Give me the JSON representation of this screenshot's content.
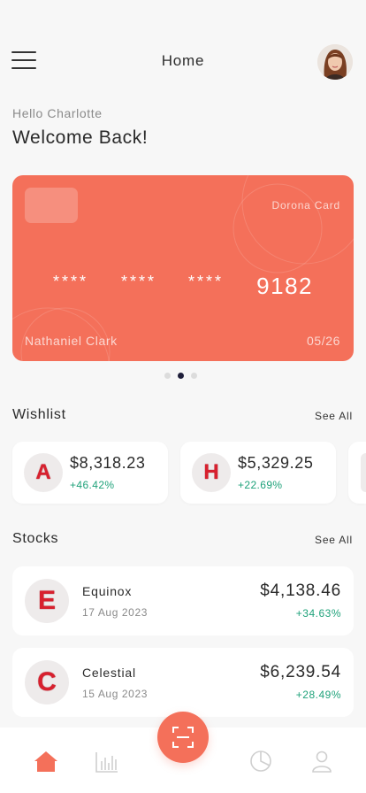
{
  "header": {
    "title": "Home"
  },
  "greeting": {
    "hello": "Hello Charlotte",
    "welcome": "Welcome Back!"
  },
  "card": {
    "brand": "Dorona Card",
    "masked_groups": [
      "****",
      "****",
      "****"
    ],
    "last_digits": "9182",
    "holder": "Nathaniel Clark",
    "expiry": "05/26",
    "color": "#f4705a"
  },
  "carousel": {
    "count": 3,
    "active_index": 1
  },
  "wishlist": {
    "title": "Wishlist",
    "see_all": "See All",
    "items": [
      {
        "logo_letter": "A",
        "price": "$8,318.23",
        "change": "+46.42%"
      },
      {
        "logo_letter": "H",
        "price": "$5,329.25",
        "change": "+22.69%"
      }
    ]
  },
  "stocks": {
    "title": "Stocks",
    "see_all": "See All",
    "items": [
      {
        "logo_letter": "E",
        "name": "Equinox",
        "date": "17 Aug 2023",
        "price": "$4,138.46",
        "change": "+34.63%"
      },
      {
        "logo_letter": "C",
        "name": "Celestial",
        "date": "15 Aug 2023",
        "price": "$6,239.54",
        "change": "+28.49%"
      }
    ]
  },
  "nav": {
    "items": [
      "home-icon",
      "bar-chart-icon",
      "scan-icon",
      "pie-chart-icon",
      "profile-icon"
    ],
    "active": "home-icon",
    "accent": "#f4705a",
    "inactive": "#cfcfcf"
  },
  "colors": {
    "positive": "#1fa27a",
    "logo_red": "#d8202e"
  }
}
